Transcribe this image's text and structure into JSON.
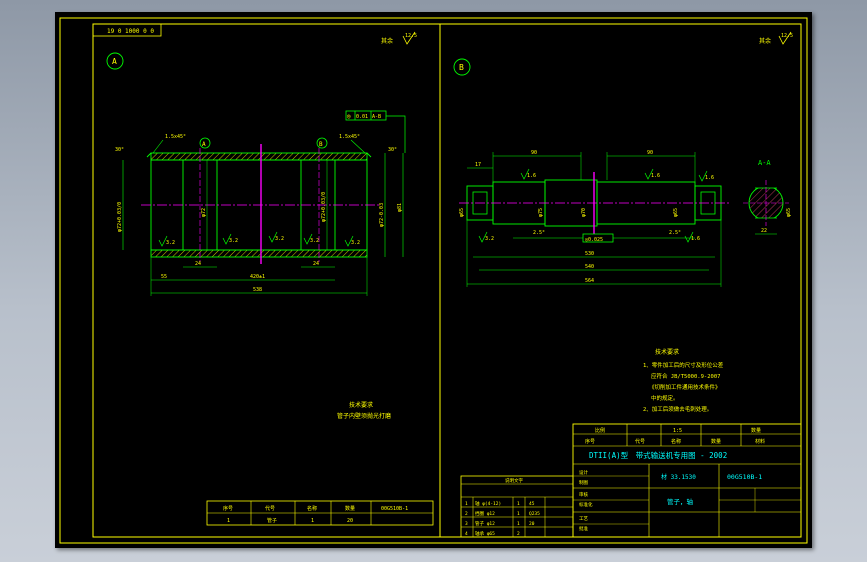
{
  "colors": {
    "frame": "#ffff00",
    "outline": "#00ff00",
    "dimension": "#00ff00",
    "center_line": "#ff00ff",
    "hatch": "#ffff00",
    "annotation": "#ffff00",
    "background": "#000000"
  },
  "top_left_tag": "19 0 1000 0 0",
  "view_a": {
    "label": "A",
    "roughness_note": "其余",
    "roughness_value": "12.5",
    "chamfer_left": "1.5x45°",
    "chamfer_right": "1.5x45°",
    "angle_left": "30°",
    "angle_right": "30°",
    "datum_1": "A",
    "datum_2": "B",
    "tolerance_frame": [
      "◎",
      "0.01",
      "A-B"
    ],
    "dims": {
      "bore_left": "φ72+0.03/0",
      "bore_inner": "φ72",
      "bore_right": "φ72+0.03/0",
      "outer_dia": "φ72-0.03",
      "outer_right": "φ81",
      "len_left": "24",
      "len_right": "24",
      "len_inner": "420±1",
      "len_left_step": "55",
      "total": "538"
    },
    "roughness_marks": [
      "3.2",
      "3.2",
      "3.2",
      "3.2",
      "3.2"
    ],
    "tech_title": "技术要求",
    "tech_text": "管子内壁须抛光打磨"
  },
  "view_b": {
    "label": "B",
    "roughness_note": "其余",
    "roughness_value": "12.5",
    "section_label": "A-A",
    "dims": {
      "left_90": "90",
      "right_90": "90",
      "key_17": "17",
      "bearing_dia": "φ65",
      "shaft_dia": "φ75",
      "mid_dia": "φ70",
      "right_dia": "φ65",
      "chamfer_left": "2.5°",
      "chamfer_right": "2.5°",
      "tol_frame": "◎0.025",
      "len_530": "530",
      "len_540": "540",
      "len_564": "564",
      "section_width": "22",
      "section_dia": "φ65"
    },
    "roughness_marks": [
      "1.6",
      "1.6",
      "3.2",
      "1.6",
      "1.6"
    ],
    "tech_title": "技术要求",
    "tech_items": [
      "1、零件加工后的尺寸及形位公差",
      "应符合 JB/T5000.9-2007",
      "《切削加工件通用技术条件》",
      "中的规定。",
      "2、加工后须做去毛刺处理。"
    ]
  },
  "title_block": {
    "product": "DTII(A)型　带式输送机专用图 - 2002",
    "drawing_no": "DTII(A)型",
    "part_no": "00G510B-1",
    "part_name": "管子，轴",
    "material": "材 33.1530",
    "scale_row": [
      "比例",
      "第",
      "1:5",
      "共",
      "数量",
      "1"
    ],
    "header_row": [
      "序号",
      "代号",
      "名称",
      "数量",
      "材料",
      "单重",
      "总重",
      "备注"
    ],
    "sign_rows": [
      "设计",
      "制图",
      "审核",
      "标准化",
      "工艺",
      "批准"
    ]
  },
  "left_title_block": {
    "cells": [
      "序号",
      "代号",
      "名称",
      "数量",
      "材料",
      "质量",
      "备注",
      "00G510B-1"
    ],
    "row2": [
      "1",
      "管子",
      "1",
      "20",
      "",
      "",
      "",
      ""
    ]
  },
  "parts_list": {
    "title": "说明文字",
    "rows": [
      [
        "1",
        "轴 φ(4-12)",
        "1",
        "45",
        "",
        "",
        ""
      ],
      [
        "2",
        "挡圈 φ12",
        "1",
        "Q235",
        "",
        "",
        ""
      ],
      [
        "3",
        "管子 φ12",
        "1",
        "20",
        "",
        "",
        ""
      ],
      [
        "4",
        "轴承 φ65",
        "2",
        "",
        "",
        "",
        ""
      ]
    ]
  }
}
